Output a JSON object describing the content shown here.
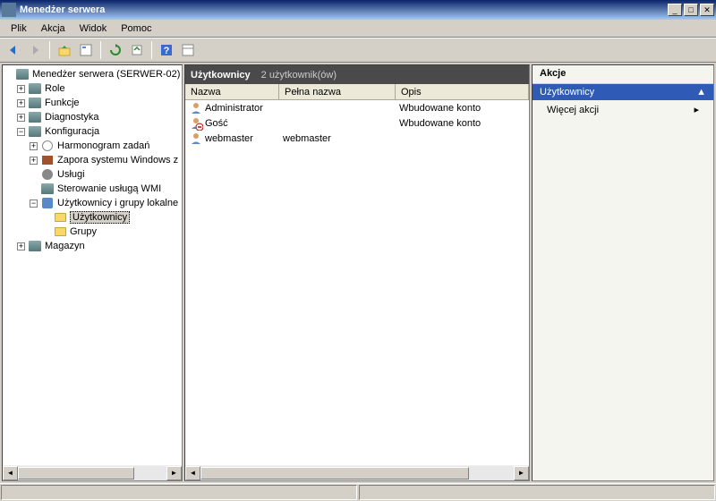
{
  "title": "Menedżer serwera",
  "menus": [
    "Plik",
    "Akcja",
    "Widok",
    "Pomoc"
  ],
  "winbtns": {
    "min": "_",
    "max": "□",
    "close": "✕"
  },
  "tree": {
    "root": "Menedżer serwera (SERWER-02)",
    "role": "Role",
    "func": "Funkcje",
    "diag": "Diagnostyka",
    "konf": "Konfiguracja",
    "harm": "Harmonogram zadań",
    "zapora": "Zapora systemu Windows z",
    "uslugi": "Usługi",
    "wmi": "Sterowanie usługą WMI",
    "ugl": "Użytkownicy i grupy lokalne",
    "uzyt": "Użytkownicy",
    "grupy": "Grupy",
    "magazyn": "Magazyn"
  },
  "list": {
    "title": "Użytkownicy",
    "count": "2 użytkownik(ów)",
    "cols": {
      "nazwa": "Nazwa",
      "pelna": "Pełna nazwa",
      "opis": "Opis"
    },
    "rows": [
      {
        "name": "Administrator",
        "full": "",
        "desc": "Wbudowane konto"
      },
      {
        "name": "Gość",
        "full": "",
        "desc": "Wbudowane konto"
      },
      {
        "name": "webmaster",
        "full": "webmaster",
        "desc": ""
      }
    ]
  },
  "actions": {
    "title": "Akcje",
    "section": "Użytkownicy",
    "more": "Więcej akcji"
  },
  "colw": {
    "c1": 105,
    "c2": 130,
    "c3": 120
  }
}
